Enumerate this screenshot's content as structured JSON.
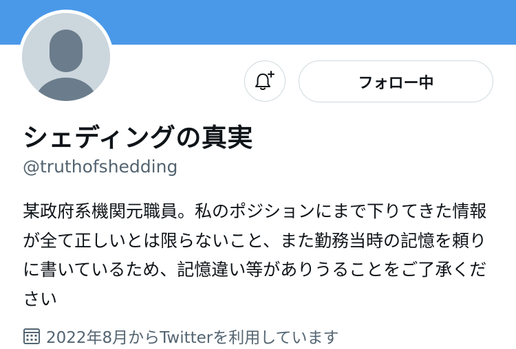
{
  "colors": {
    "banner": "#4a99e9",
    "avatar_bg": "#ccd6dd",
    "avatar_fg": "#6b7d8c",
    "secondary_text": "#536471",
    "border": "#cfd9de"
  },
  "header": {
    "notify_icon": "bell-plus-icon",
    "follow_label": "フォロー中"
  },
  "profile": {
    "name": "シェディングの真実",
    "handle": "@truthofshedding",
    "bio": "某政府系機関元職員。私のポジションにまで下りてきた情報が全て正しいとは限らないこと、また勤務当時の記憶を頼りに書いているため、記憶違い等がありうることをご了承ください",
    "joined_icon": "calendar-icon",
    "joined": "2022年8月からTwitterを利用しています"
  }
}
